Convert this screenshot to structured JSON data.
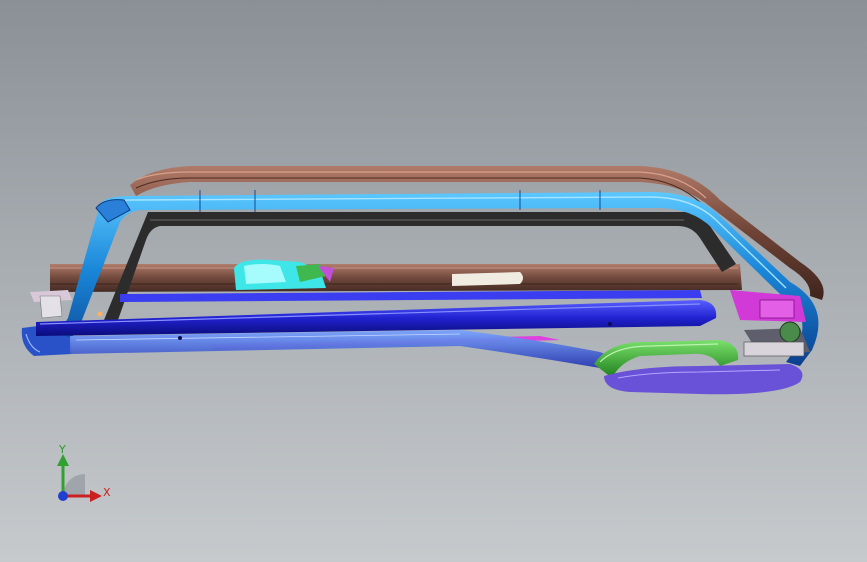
{
  "viewport": {
    "background_top": "#8a9096",
    "background_bottom": "#c6cacd"
  },
  "model": {
    "description_icon": "cad-assembly-model",
    "colors": {
      "frame_blue": "#1d63d6",
      "frame_cyan": "#1fa4e8",
      "rail_brown": "#7a4a3c",
      "channel_dark": "#3b3b3b",
      "rod_blue": "#2233d8",
      "accent_magenta": "#c020c8",
      "accent_green": "#2fa82b",
      "accent_cyan": "#3fe0e0",
      "accent_purple": "#6a50d8"
    }
  },
  "triad": {
    "x_label": "X",
    "y_label": "Y",
    "x_color": "#cc2020",
    "y_color": "#2a9a2a",
    "z_color": "#2040d0"
  }
}
